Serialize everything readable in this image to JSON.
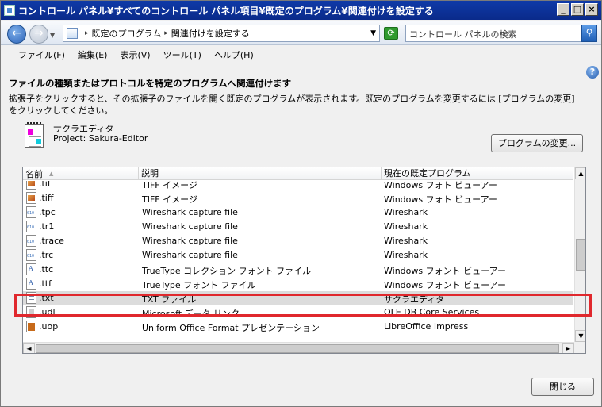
{
  "window": {
    "title": "コントロール パネル¥すべてのコントロール パネル項目¥既定のプログラム¥関連付けを設定する",
    "min": "_",
    "max": "□",
    "close": "×"
  },
  "address": {
    "crumb1": "既定のプログラム",
    "crumb2": "関連付けを設定する",
    "search_placeholder": "コントロール パネルの検索"
  },
  "menu": [
    "ファイル(F)",
    "編集(E)",
    "表示(V)",
    "ツール(T)",
    "ヘルプ(H)"
  ],
  "page": {
    "heading": "ファイルの種類またはプロトコルを特定のプログラムへ関連付けます",
    "description": "拡張子をクリックすると、その拡張子のファイルを開く既定のプログラムが表示されます。既定のプログラムを変更するには [プログラムの変更] をクリックしてください。",
    "program_name": "サクラエディタ",
    "program_company": "Project: Sakura-Editor",
    "change_button": "プログラムの変更...",
    "close_button": "閉じる"
  },
  "table": {
    "headers": [
      "名前",
      "説明",
      "現在の既定プログラム"
    ],
    "rows": [
      {
        "icon": "image-file-icon",
        "name": ".tif",
        "desc": "TIFF イメージ",
        "program": "Windows フォト ビューアー"
      },
      {
        "icon": "image-file-icon",
        "name": ".tiff",
        "desc": "TIFF イメージ",
        "program": "Windows フォト ビューアー"
      },
      {
        "icon": "wireshark-file-icon",
        "name": ".tpc",
        "desc": "Wireshark capture file",
        "program": "Wireshark"
      },
      {
        "icon": "wireshark-file-icon",
        "name": ".tr1",
        "desc": "Wireshark capture file",
        "program": "Wireshark"
      },
      {
        "icon": "wireshark-file-icon",
        "name": ".trace",
        "desc": "Wireshark capture file",
        "program": "Wireshark"
      },
      {
        "icon": "wireshark-file-icon",
        "name": ".trc",
        "desc": "Wireshark capture file",
        "program": "Wireshark"
      },
      {
        "icon": "font-file-icon",
        "name": ".ttc",
        "desc": "TrueType コレクション フォント ファイル",
        "program": "Windows フォント ビューアー"
      },
      {
        "icon": "font-file-icon",
        "name": ".ttf",
        "desc": "TrueType フォント ファイル",
        "program": "Windows フォント ビューアー"
      },
      {
        "icon": "text-file-icon",
        "name": ".txt",
        "desc": "TXT ファイル",
        "program": "サクラエディタ",
        "selected": true
      },
      {
        "icon": "udl-file-icon",
        "name": ".udl",
        "desc": "Microsoft データ リンク",
        "program": "OLE DB Core Services"
      },
      {
        "icon": "office-doc-icon",
        "name": ".uop",
        "desc": "Uniform Office Format プレゼンテーション",
        "program": "LibreOffice Impress"
      }
    ]
  }
}
